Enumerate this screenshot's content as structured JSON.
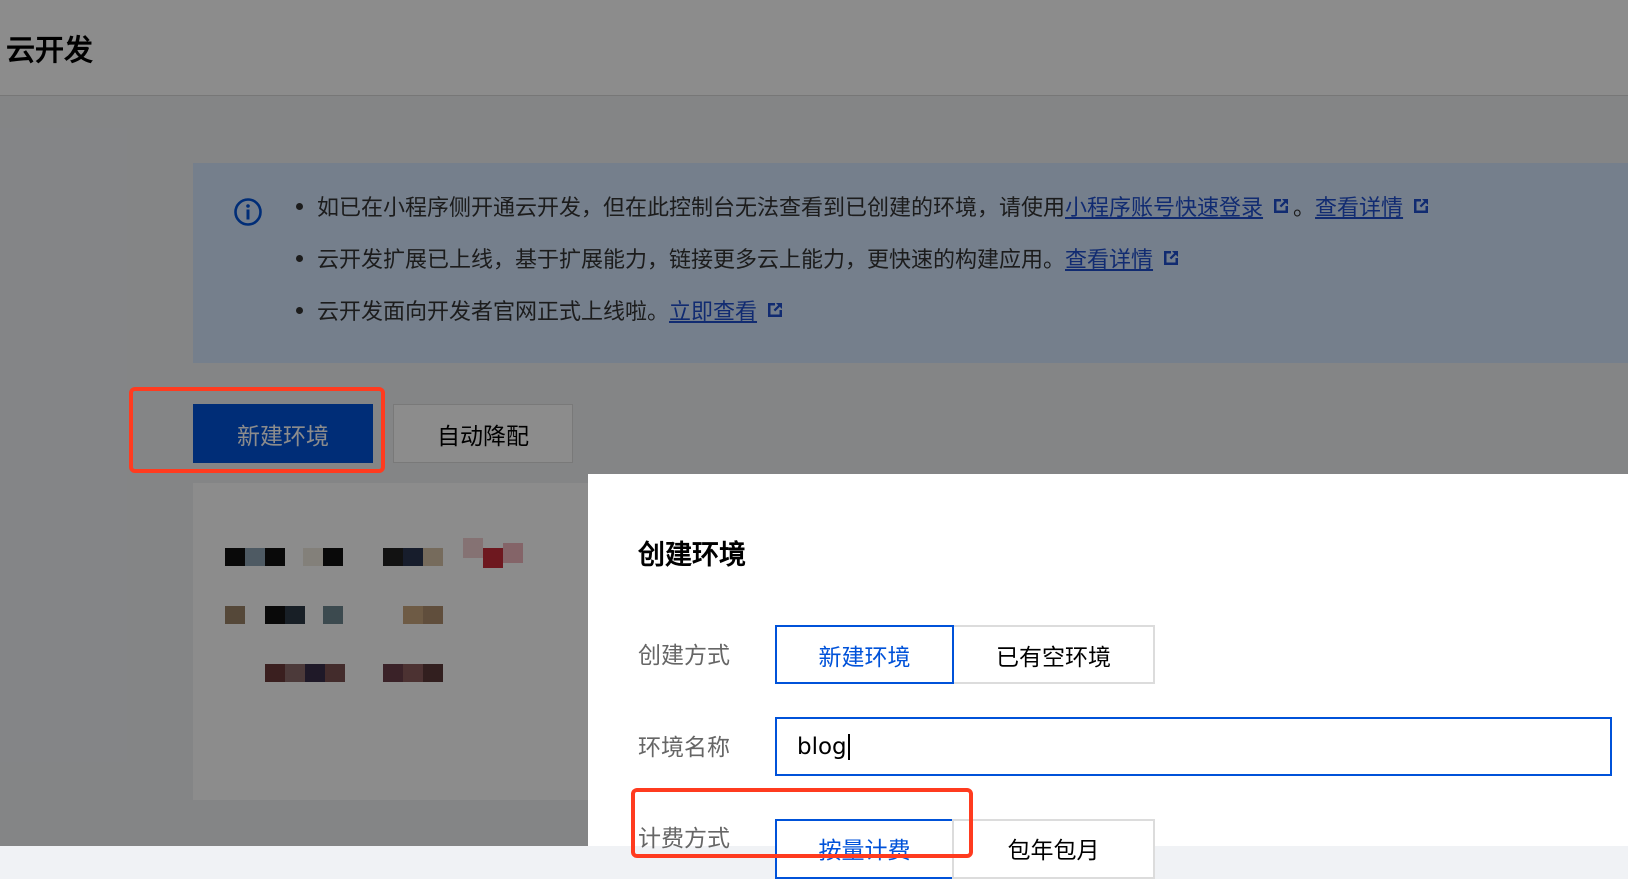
{
  "header": {
    "title": "云开发"
  },
  "notice": {
    "line1": {
      "text": "如已在小程序侧开通云开发，但在此控制台无法查看到已创建的环境，请使用",
      "link1": "小程序账号快速登录",
      "sep": "。",
      "link2": "查看详情"
    },
    "line2": {
      "text": "云开发扩展已上线，基于扩展能力，链接更多云上能力，更快速的构建应用。",
      "link": "查看详情"
    },
    "line3": {
      "text": "云开发面向开发者官网正式上线啦。",
      "link": "立即查看"
    }
  },
  "toolbar": {
    "new_env_label": "新建环境",
    "auto_downgrade_label": "自动降配"
  },
  "colors": {
    "primary": "#0052d9",
    "highlight": "#ff3b1f",
    "notice_bg": "#d5e7ff",
    "link": "#1f4fce"
  },
  "icons": {
    "info": "info-circle-icon",
    "external": "external-link-icon"
  },
  "modal": {
    "title": "创建环境",
    "create_method": {
      "label": "创建方式",
      "options": [
        "新建环境",
        "已有空环境"
      ],
      "selected": "新建环境"
    },
    "env_name": {
      "label": "环境名称",
      "value": "blog"
    },
    "billing": {
      "label": "计费方式",
      "options": [
        "按量计费",
        "包年包月"
      ],
      "selected": "按量计费"
    }
  }
}
